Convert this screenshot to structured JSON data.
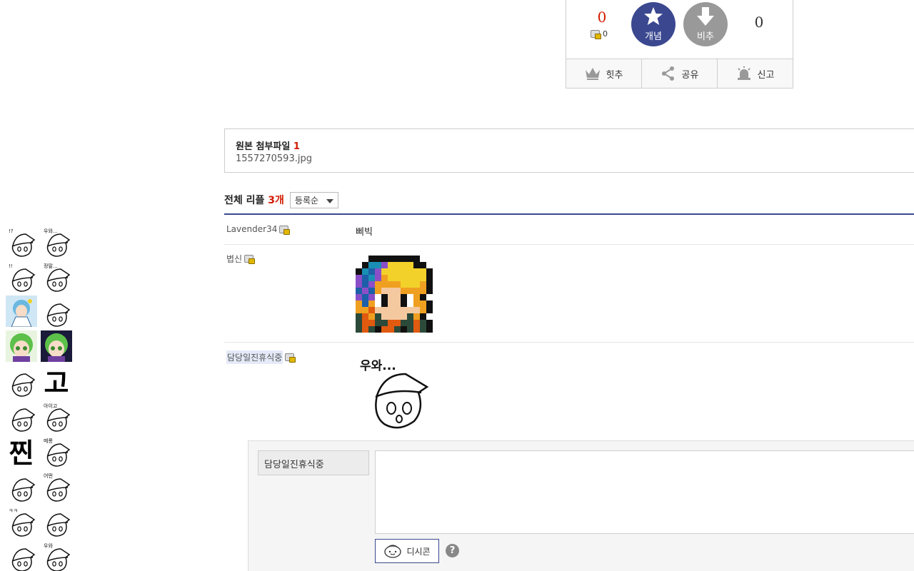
{
  "vote": {
    "up_count": "0",
    "fix_count": "0",
    "up_label": "개념",
    "down_label": "비추",
    "down_count": "0",
    "actions": [
      {
        "label": "힛추",
        "icon": "crown-icon"
      },
      {
        "label": "공유",
        "icon": "share-icon"
      },
      {
        "label": "신고",
        "icon": "siren-icon"
      }
    ]
  },
  "attachment": {
    "title": "원본 첨부파일",
    "count": "1",
    "file_name": "1557270593.jpg"
  },
  "comments": {
    "title": "전체 리플",
    "count": "3개",
    "sort": "등록순",
    "items": [
      {
        "nick": "Lavender34",
        "text": "삐빅",
        "type": "text"
      },
      {
        "nick": "볍신",
        "type": "dccon-pixel"
      },
      {
        "nick": "담당일진휴식중",
        "type": "dccon-sketch",
        "sketch_caption": "우와..."
      }
    ]
  },
  "reply": {
    "nick": "담당일진휴식중",
    "dccon_label": "디시콘",
    "help": "?"
  },
  "stickers": {
    "items": [
      {
        "icon": "witch-sticker-icon",
        "caption": "!?"
      },
      {
        "icon": "witch-sticker-icon",
        "caption": "우와..."
      },
      {
        "icon": "witch-sticker-icon",
        "caption": "!!"
      },
      {
        "icon": "witch-sticker-icon",
        "caption": "정말..."
      },
      {
        "icon": "anime-girl-sticker-icon",
        "caption": ""
      },
      {
        "icon": "witch-sticker-icon",
        "caption": ""
      },
      {
        "icon": "green-hair-sticker-icon",
        "caption": ""
      },
      {
        "icon": "green-hair-sticker-icon",
        "caption": ""
      },
      {
        "icon": "witch-sticker-icon",
        "caption": ""
      },
      {
        "icon": "text-sticker-icon",
        "caption": "고"
      },
      {
        "icon": "witch-sticker-icon",
        "caption": ""
      },
      {
        "icon": "witch-sticker-icon",
        "caption": "아이고"
      },
      {
        "icon": "text-sticker-icon",
        "caption": "찐"
      },
      {
        "icon": "witch-sticker-icon",
        "caption": "메롱"
      },
      {
        "icon": "witch-sticker-icon",
        "caption": ""
      },
      {
        "icon": "witch-sticker-icon",
        "caption": "어떤"
      },
      {
        "icon": "witch-sticker-icon",
        "caption": "ㅋㅋ"
      },
      {
        "icon": "witch-sticker-icon",
        "caption": ""
      },
      {
        "icon": "witch-sticker-icon",
        "caption": ""
      },
      {
        "icon": "witch-sticker-icon",
        "caption": "우와"
      }
    ]
  }
}
